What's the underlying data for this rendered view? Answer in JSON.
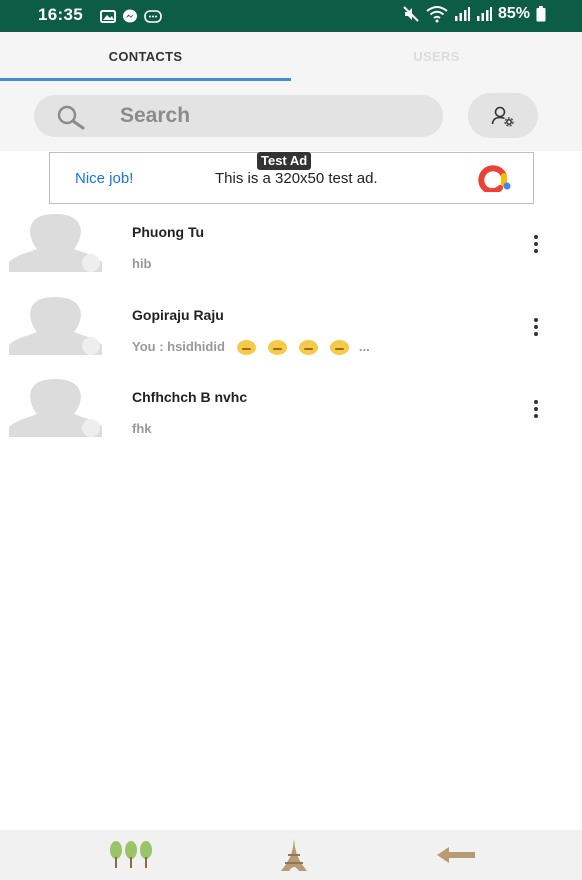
{
  "status_bar": {
    "time": "16:35",
    "battery": "85%",
    "icons": [
      "gallery-icon",
      "messenger-icon",
      "chat-icon",
      "mute-icon",
      "wifi-icon",
      "signal-icon",
      "signal-icon",
      "battery-icon"
    ]
  },
  "tabs": [
    {
      "label": "CONTACTS",
      "active": true
    },
    {
      "label": "USERS",
      "active": false
    }
  ],
  "search": {
    "placeholder": "Search",
    "icon": "search-icon",
    "settings_icon": "user-settings-icon"
  },
  "ad": {
    "badge": "Test Ad",
    "title": "Nice job!",
    "text": "This is a 320x50 test ad."
  },
  "contacts": [
    {
      "name": "Phuong Tu",
      "message": "hib"
    },
    {
      "name": "Gopiraju Raju",
      "message": "You : hsidhidid",
      "emoji_count": 4,
      "ellipsis": "..."
    },
    {
      "name": "Chfhchch B nvhc",
      "message": "fhk"
    }
  ],
  "bottom_nav": {
    "items": [
      "trees-icon",
      "eiffel-tower-icon",
      "back-arrow-icon"
    ]
  },
  "colors": {
    "status_bar": "#0d5c45",
    "tab_underline": "#3f8fd2",
    "ad_link": "#1a73e8",
    "nav_icon": "#b89b74",
    "tree_green": "#9ac46a"
  }
}
